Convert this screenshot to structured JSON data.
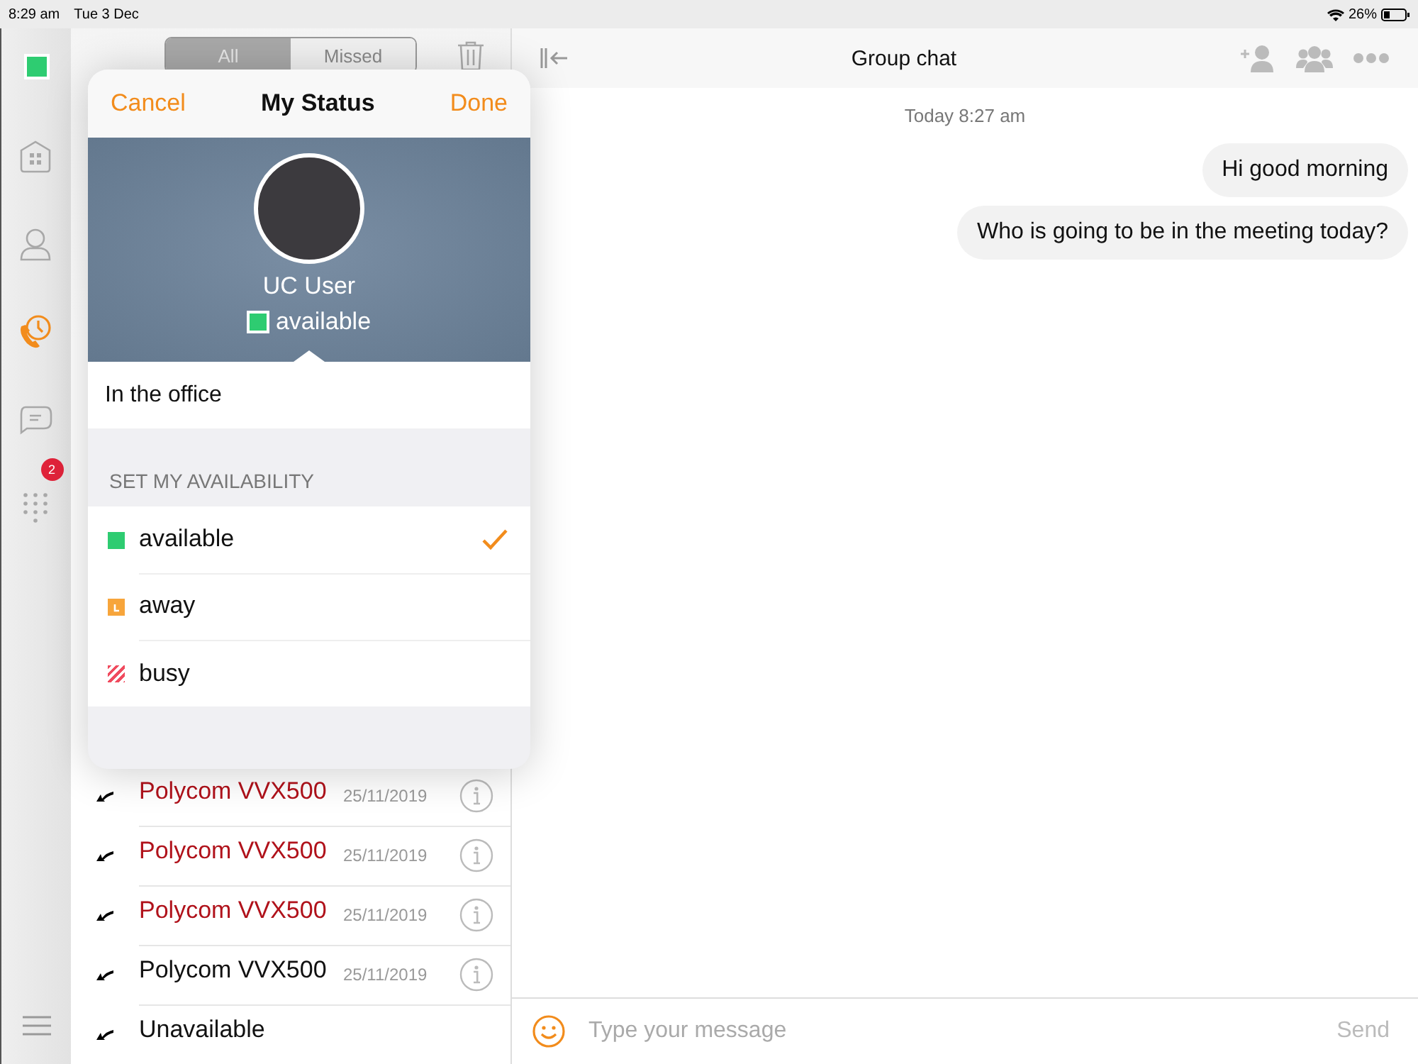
{
  "status_bar": {
    "time": "8:29 am",
    "date": "Tue 3 Dec",
    "battery": "26%"
  },
  "nav": {
    "presence": {
      "kind": "available"
    },
    "items": [
      {
        "kind": "home",
        "selected": false
      },
      {
        "kind": "contacts",
        "selected": false
      },
      {
        "kind": "history",
        "selected": true
      },
      {
        "kind": "chat",
        "selected": false
      },
      {
        "kind": "dialpad",
        "selected": false,
        "badge": "2"
      }
    ]
  },
  "calls": {
    "filter_tabs": [
      {
        "label": "All",
        "selected": true
      },
      {
        "label": "Missed",
        "selected": false
      }
    ],
    "rows": [
      {
        "name": "Polycom VVX500",
        "date": "25/11/2019",
        "missed": true
      },
      {
        "name": "Polycom VVX500",
        "date": "25/11/2019",
        "missed": true
      },
      {
        "name": "Polycom VVX500",
        "date": "25/11/2019",
        "missed": true
      },
      {
        "name": "Polycom VVX500",
        "date": "25/11/2019",
        "missed": false
      },
      {
        "name": "Unavailable",
        "missed": false
      }
    ]
  },
  "popover": {
    "cancel": "Cancel",
    "title": "My Status",
    "done": "Done",
    "user_name": "UC User",
    "current_status": {
      "kind": "available",
      "label": "available"
    },
    "note": "In the office",
    "section": "SET MY AVAILABILITY",
    "options": [
      {
        "kind": "available",
        "label": "available",
        "selected": true
      },
      {
        "kind": "away",
        "label": "away",
        "selected": false
      },
      {
        "kind": "busy",
        "label": "busy",
        "selected": false
      }
    ]
  },
  "chat": {
    "title": "Group chat",
    "timestamp": "Today 8:27 am",
    "messages": [
      "Hi good morning",
      "Who is going to be in the meeting today?"
    ],
    "input": {
      "placeholder": "Type your message"
    },
    "send": "Send"
  }
}
